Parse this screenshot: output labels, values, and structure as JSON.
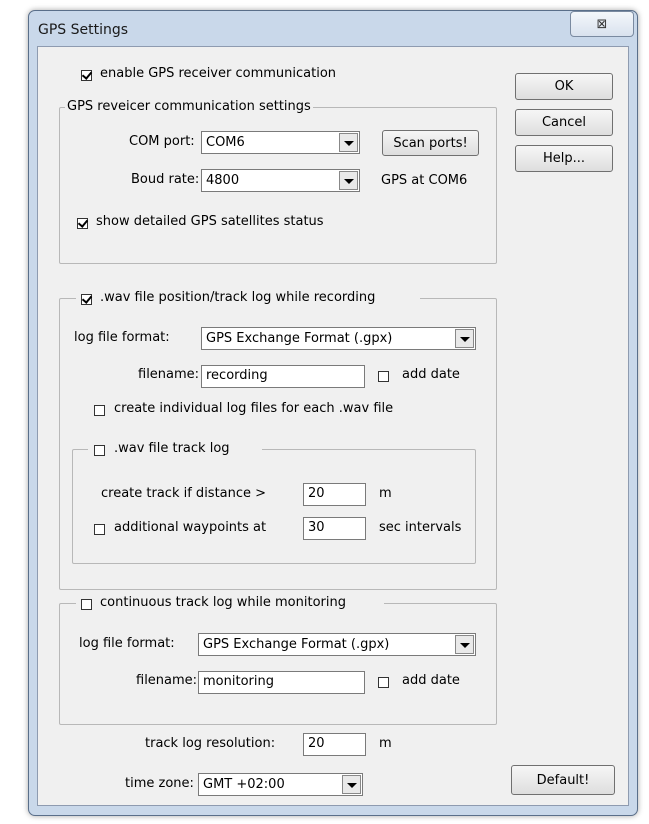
{
  "window": {
    "title": "GPS Settings",
    "close_glyph": "⊠"
  },
  "buttons": {
    "ok": "OK",
    "cancel": "Cancel",
    "help": "Help...",
    "default": "Default!",
    "scan_ports": "Scan ports!"
  },
  "gps": {
    "enable_label": "enable GPS receiver communication",
    "enable_checked": true,
    "group_label": "GPS reveicer communication settings",
    "com_port_label": "COM port:",
    "com_port_value": "COM6",
    "baud_label": "Boud rate:",
    "baud_value": "4800",
    "status_text": "GPS at COM6",
    "detailed_label": "show detailed GPS satellites status",
    "detailed_checked": true
  },
  "wav": {
    "group_label": ".wav file position/track log while recording",
    "group_checked": true,
    "format_label": "log file format:",
    "format_value": "GPS Exchange Format (.gpx)",
    "filename_label": "filename:",
    "filename_value": "recording",
    "add_date_label": "add date",
    "add_date_checked": false,
    "individual_label": "create individual log files for each .wav file",
    "individual_checked": false,
    "track": {
      "group_label": ".wav file track log",
      "group_checked": false,
      "distance_label": "create track if distance >",
      "distance_value": "20",
      "distance_unit": "m",
      "waypoints_label": "additional waypoints at",
      "waypoints_checked": false,
      "waypoints_value": "30",
      "waypoints_unit": "sec intervals"
    }
  },
  "continuous": {
    "group_label": "continuous track log while monitoring",
    "group_checked": false,
    "format_label": "log file format:",
    "format_value": "GPS Exchange Format (.gpx)",
    "filename_label": "filename:",
    "filename_value": "monitoring",
    "add_date_label": "add date",
    "add_date_checked": false
  },
  "resolution": {
    "label": "track log resolution:",
    "value": "20",
    "unit": "m"
  },
  "timezone": {
    "label": "time zone:",
    "value": "GMT +02:00"
  }
}
